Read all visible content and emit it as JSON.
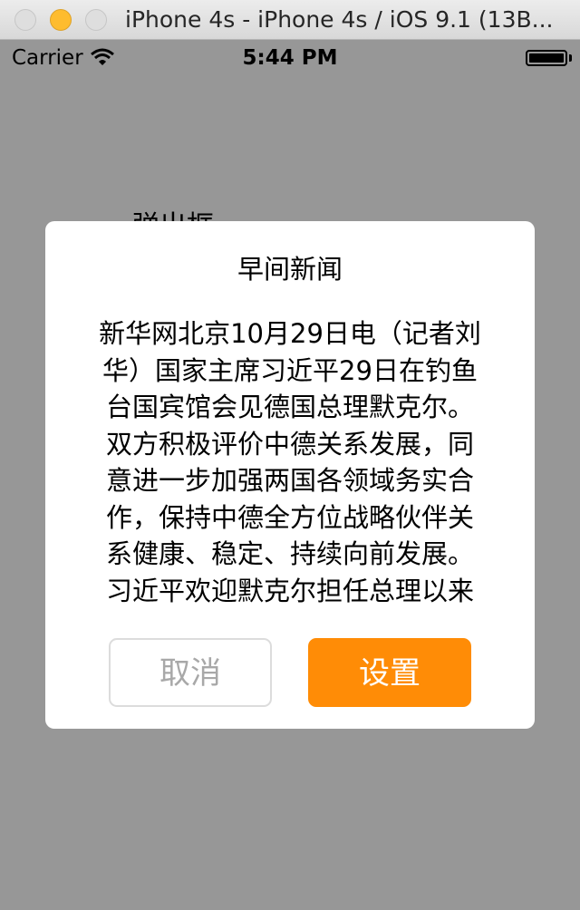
{
  "window": {
    "title": "iPhone 4s - iPhone 4s / iOS 9.1 (13B..."
  },
  "status_bar": {
    "carrier": "Carrier",
    "time": "5:44 PM",
    "icons": [
      "wifi-icon",
      "battery-icon"
    ]
  },
  "background": {
    "label": "弹出框"
  },
  "alert": {
    "title": "早间新闻",
    "message": "新华网北京10月29日电（记者刘华）国家主席习近平29日在钓鱼台国宾馆会见德国总理默克尔。双方积极评价中德关系发展，同意进一步加强两国各领域务实合作，保持中德全方位战略伙伴关系健康、稳定、持续向前发展。习近平欢迎默克尔担任总理以来第八次访华。",
    "cancel_label": "取消",
    "confirm_label": "设置",
    "colors": {
      "confirm_background": "#ff8c06",
      "cancel_text": "#a8a8a8"
    }
  }
}
